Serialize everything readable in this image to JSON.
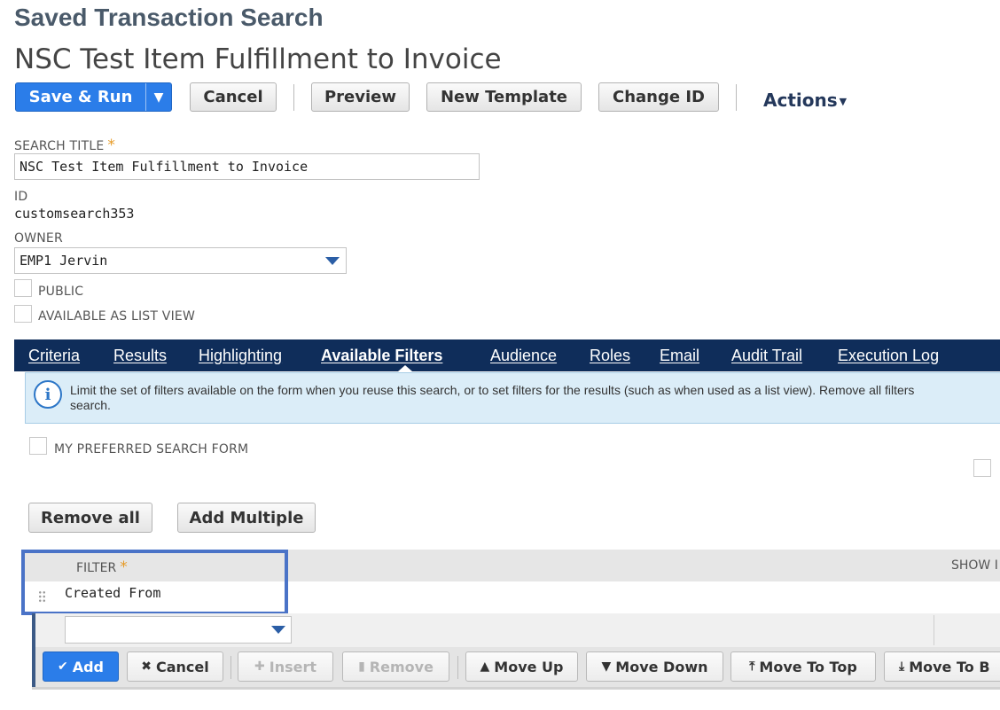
{
  "page": {
    "header": "Saved Transaction Search",
    "title": "NSC Test Item Fulfillment to Invoice"
  },
  "toolbar": {
    "save_run": "Save & Run",
    "cancel": "Cancel",
    "preview": "Preview",
    "new_template": "New Template",
    "change_id": "Change ID",
    "actions": "Actions"
  },
  "form": {
    "search_title_label": "SEARCH TITLE",
    "search_title_value": "NSC Test Item Fulfillment to Invoice",
    "id_label": "ID",
    "id_value": "customsearch353",
    "owner_label": "OWNER",
    "owner_value": "EMP1 Jervin",
    "public_label": "PUBLIC",
    "list_view_label": "AVAILABLE AS LIST VIEW",
    "required_mark": "*"
  },
  "tabs": [
    {
      "label": "Criteria"
    },
    {
      "label": "Results"
    },
    {
      "label": "Highlighting"
    },
    {
      "label": "Available Filters",
      "active": true
    },
    {
      "label": "Audience"
    },
    {
      "label": "Roles"
    },
    {
      "label": "Email"
    },
    {
      "label": "Audit Trail"
    },
    {
      "label": "Execution Log"
    }
  ],
  "info": {
    "line1": "Limit the set of filters available on the form when you reuse this search, or to set filters for the results (such as when used as a list view). Remove all filters",
    "line2": "search."
  },
  "filters": {
    "preferred_label": "MY PREFERRED SEARCH FORM",
    "remove_all": "Remove all",
    "add_multiple": "Add Multiple",
    "col_filter": "FILTER",
    "col_show": "SHOW I",
    "rows": [
      "Created From"
    ]
  },
  "machine": {
    "add": "Add",
    "cancel": "Cancel",
    "insert": "Insert",
    "remove": "Remove",
    "move_up": "Move Up",
    "move_down": "Move Down",
    "move_to_top": "Move To Top",
    "move_to_bottom": "Move To B"
  },
  "colors": {
    "primary": "#2b7de9",
    "tabbar": "#0f2d5a",
    "required": "#e69b28",
    "highlight_box": "#4a73c7"
  }
}
